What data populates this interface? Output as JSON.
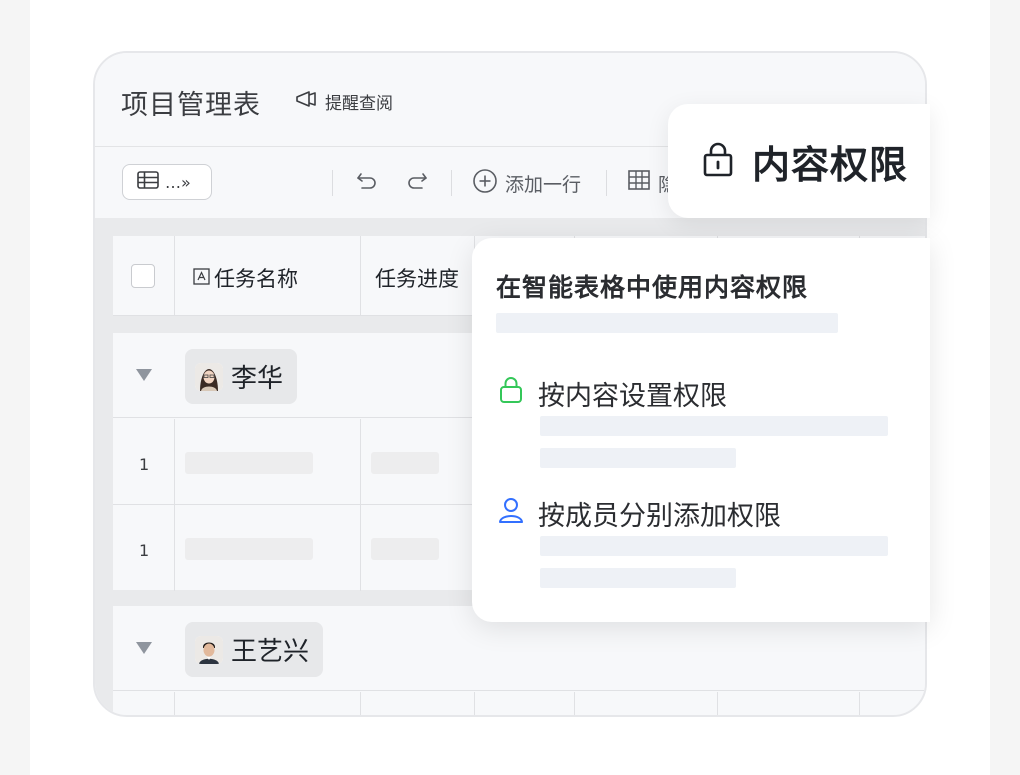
{
  "app": {
    "title": "项目管理表",
    "remind_label": "提醒查阅"
  },
  "toolbar": {
    "view_label": "…»",
    "add_row_label": "添加一行",
    "hide_label": "隐"
  },
  "table": {
    "columns": [
      "任务名称",
      "任务进度"
    ],
    "groups": [
      {
        "name": "李华",
        "rows": [
          "1",
          "1"
        ]
      },
      {
        "name": "王艺兴",
        "rows": []
      }
    ]
  },
  "badge": {
    "label": "内容权限",
    "icon": "lock-icon"
  },
  "popover": {
    "title": "在智能表格中使用内容权限",
    "options": [
      {
        "label": "按内容设置权限",
        "icon": "lock-icon",
        "color": "#34c759"
      },
      {
        "label": "按成员分别添加权限",
        "icon": "user-icon",
        "color": "#3370ff"
      }
    ]
  },
  "colors": {
    "page_bg": "#f5f5f5",
    "card_bg": "#f7f8fa",
    "placeholder": "#eef1f6"
  }
}
